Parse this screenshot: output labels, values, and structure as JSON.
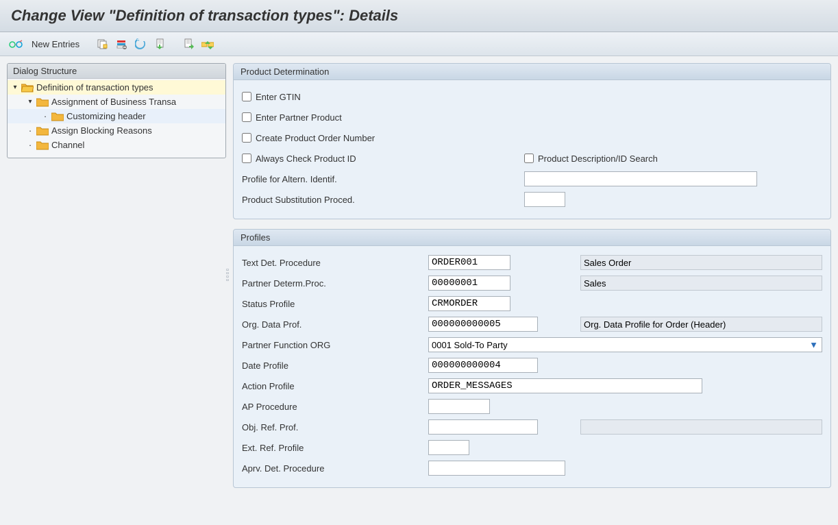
{
  "title": "Change View \"Definition of transaction types\": Details",
  "toolbar": {
    "new_entries": "New Entries"
  },
  "sidebar": {
    "header": "Dialog Structure",
    "items": {
      "definition": "Definition of transaction types",
      "assignment": "Assignment of Business Transa",
      "customizing": "Customizing header",
      "blocking": "Assign Blocking Reasons",
      "channel": "Channel"
    }
  },
  "panel1": {
    "title": "Product Determination",
    "enter_gtin": "Enter GTIN",
    "enter_partner": "Enter Partner Product",
    "create_pon": "Create Product Order Number",
    "always_check": "Always Check Product ID",
    "desc_search": "Product Description/ID Search",
    "profile_altern": "Profile for Altern. Identif.",
    "subst_proced": "Product Substitution Proced.",
    "profile_altern_val": "",
    "subst_proced_val": ""
  },
  "panel2": {
    "title": "Profiles",
    "text_det": "Text Det. Procedure",
    "text_det_val": "ORDER001",
    "text_det_desc": "Sales Order",
    "partner_det": "Partner Determ.Proc.",
    "partner_det_val": "00000001",
    "partner_det_desc": "Sales",
    "status_profile": "Status Profile",
    "status_profile_val": "CRMORDER",
    "org_data": "Org. Data Prof.",
    "org_data_val": "000000000005",
    "org_data_desc": "Org. Data Profile for Order (Header)",
    "partner_func": "Partner Function ORG",
    "partner_func_val": "0001 Sold-To Party",
    "date_profile": "Date Profile",
    "date_profile_val": "000000000004",
    "action_profile": "Action Profile",
    "action_profile_val": "ORDER_MESSAGES",
    "ap_procedure": "AP Procedure",
    "ap_procedure_val": "",
    "obj_ref": "Obj. Ref. Prof.",
    "obj_ref_val": "",
    "obj_ref_desc": "",
    "ext_ref": "Ext. Ref. Profile",
    "ext_ref_val": "",
    "aprv_det": "Aprv. Det. Procedure",
    "aprv_det_val": ""
  }
}
